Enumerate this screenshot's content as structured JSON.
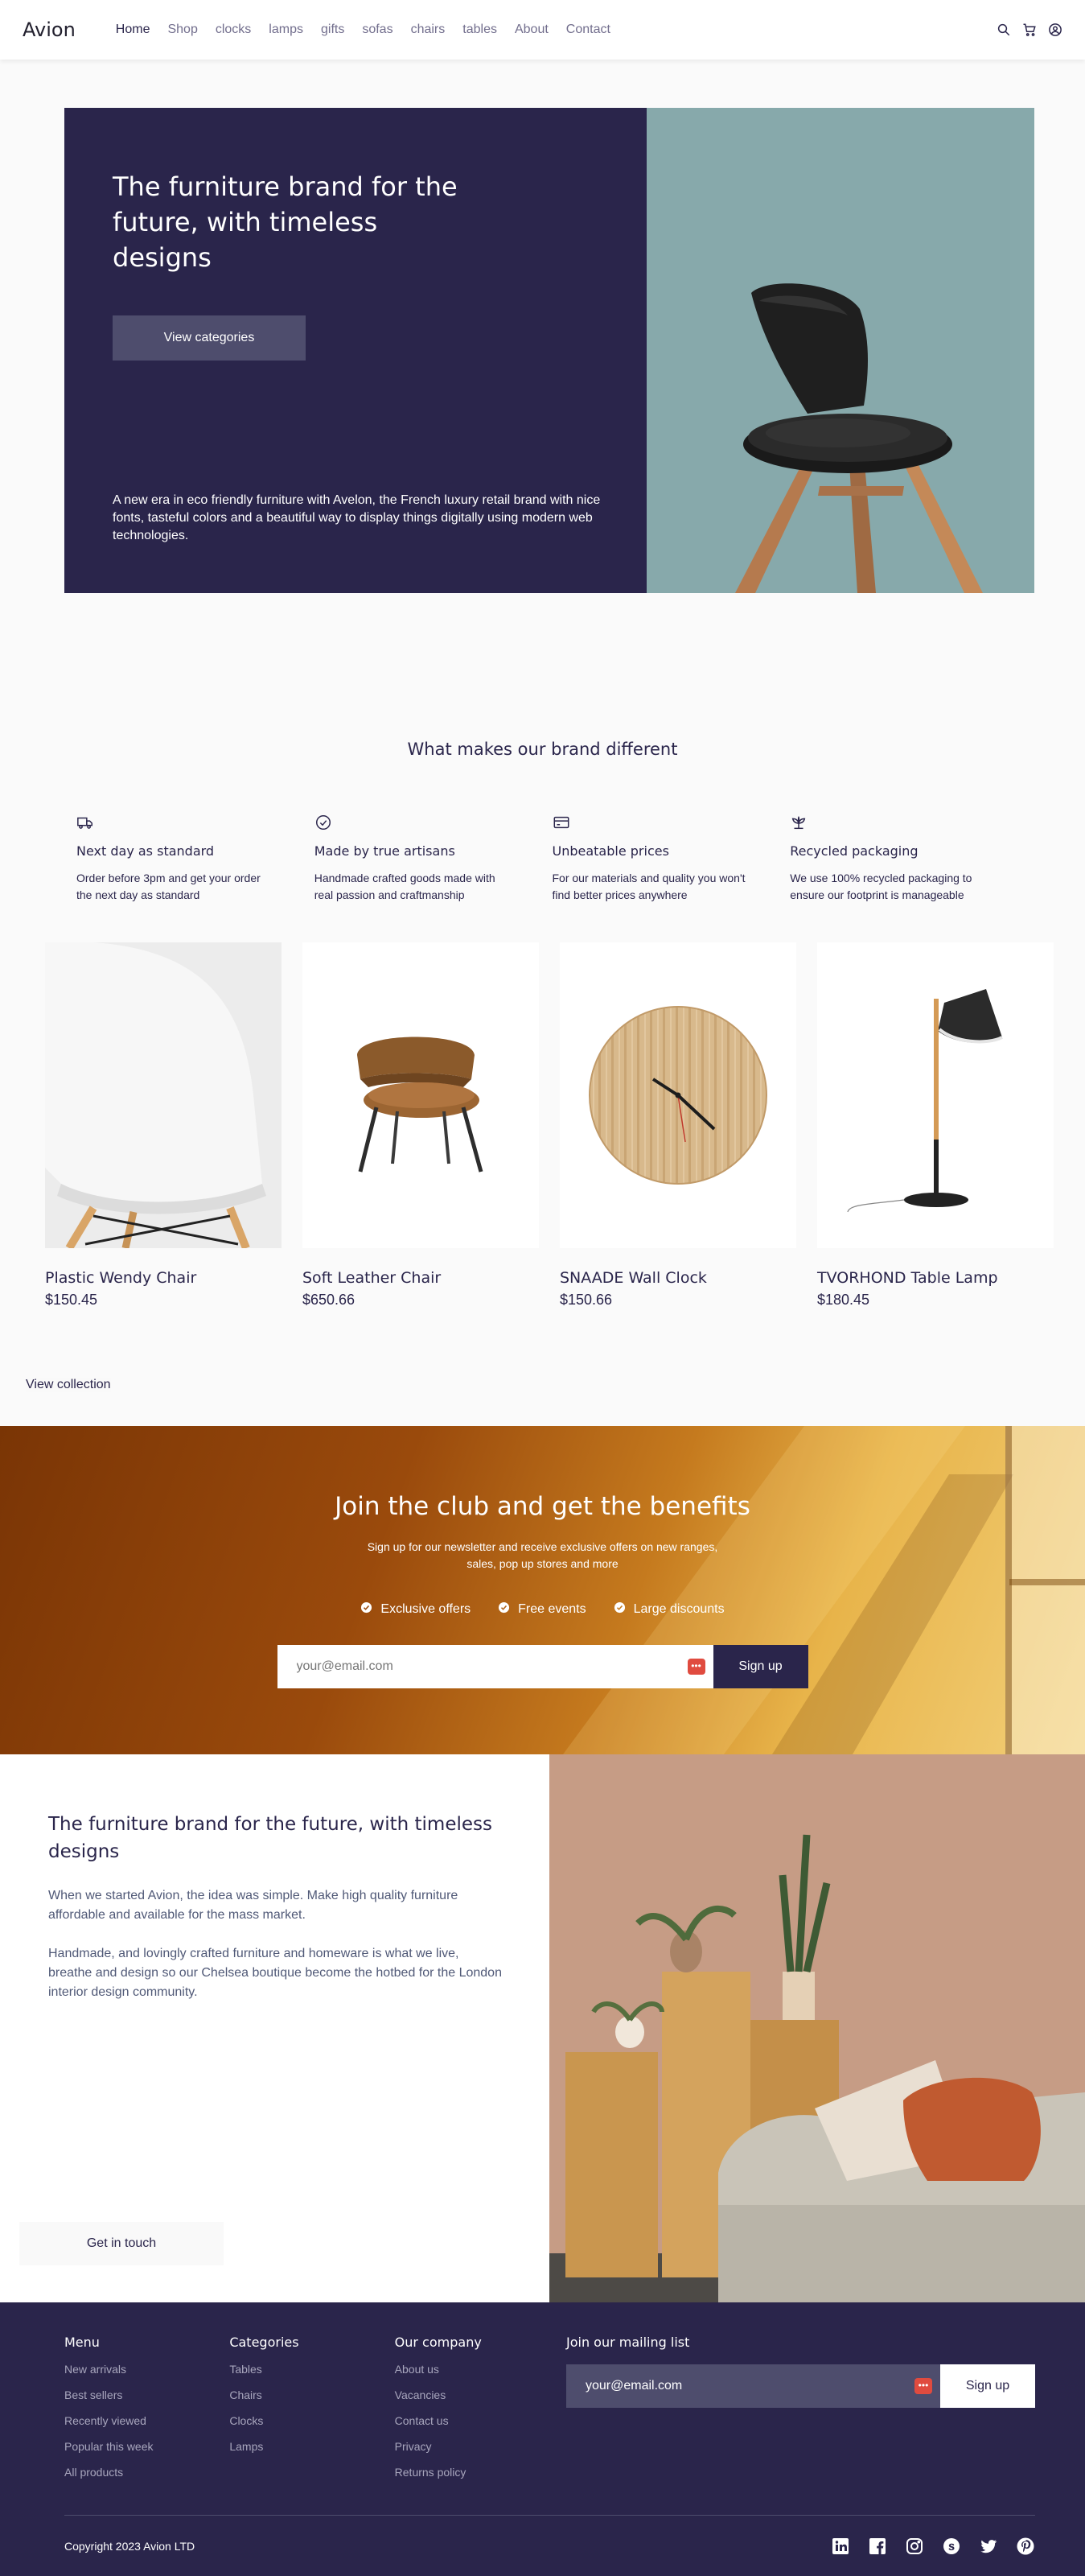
{
  "nav": {
    "logo": "Avion",
    "links": [
      "Home",
      "Shop",
      "clocks",
      "lamps",
      "gifts",
      "sofas",
      "chairs",
      "tables",
      "About",
      "Contact"
    ]
  },
  "hero": {
    "title": "The furniture brand for the future, with timeless designs",
    "button": "View categories",
    "description": "A new era in eco friendly furniture with Avelon, the French luxury retail brand with nice fonts, tasteful colors and a beautiful way to display things digitally using modern web technologies."
  },
  "features": {
    "title": "What makes our brand different",
    "items": [
      {
        "icon": "delivery-truck-icon",
        "title": "Next day as standard",
        "text": "Order before 3pm and get your order the next day as standard"
      },
      {
        "icon": "checkmark-circle-icon",
        "title": "Made by true artisans",
        "text": "Handmade crafted goods made with real passion and craftmanship"
      },
      {
        "icon": "credit-card-icon",
        "title": "Unbeatable prices",
        "text": "For our materials and quality you won't find better prices anywhere"
      },
      {
        "icon": "sprout-icon",
        "title": "Recycled packaging",
        "text": "We use 100% recycled packaging to ensure our footprint is manageable"
      }
    ]
  },
  "products": [
    {
      "name": "Plastic Wendy Chair",
      "price": "$150.45"
    },
    {
      "name": "Soft Leather Chair",
      "price": "$650.66"
    },
    {
      "name": "SNAADE Wall Clock",
      "price": "$150.66"
    },
    {
      "name": "TVORHOND Table Lamp",
      "price": "$180.45"
    }
  ],
  "view_collection": "View collection",
  "club": {
    "title": "Join the club and get the benefits",
    "subtitle": "Sign up for our newsletter and receive exclusive offers on new ranges, sales, pop up stores and more",
    "benefits": [
      "Exclusive offers",
      "Free events",
      "Large discounts"
    ],
    "email_placeholder": "your@email.com",
    "button": "Sign up"
  },
  "about": {
    "title": "The furniture brand for the future, with timeless designs",
    "paragraph1": "When we started Avion, the idea was simple. Make high quality furniture affordable and available for the mass market.",
    "paragraph2": "Handmade, and lovingly crafted furniture and homeware is what we live, breathe and design so our Chelsea boutique become the hotbed for the London interior design community.",
    "button": "Get in touch"
  },
  "footer": {
    "menu": {
      "title": "Menu",
      "items": [
        "New arrivals",
        "Best sellers",
        "Recently viewed",
        "Popular this week",
        "All products"
      ]
    },
    "categories": {
      "title": "Categories",
      "items": [
        "Tables",
        "Chairs",
        "Clocks",
        "Lamps"
      ]
    },
    "company": {
      "title": "Our company",
      "items": [
        "About us",
        "Vacancies",
        "Contact us",
        "Privacy",
        "Returns policy"
      ]
    },
    "mailing": {
      "title": "Join our mailing list",
      "email_value": "your@email.com",
      "button": "Sign up"
    },
    "copyright": "Copyright 2023 Avion LTD"
  },
  "colors": {
    "brand_dark": "#2a254b",
    "brand_mid": "#4e4d6d",
    "hero_right": "#87a9ab"
  }
}
